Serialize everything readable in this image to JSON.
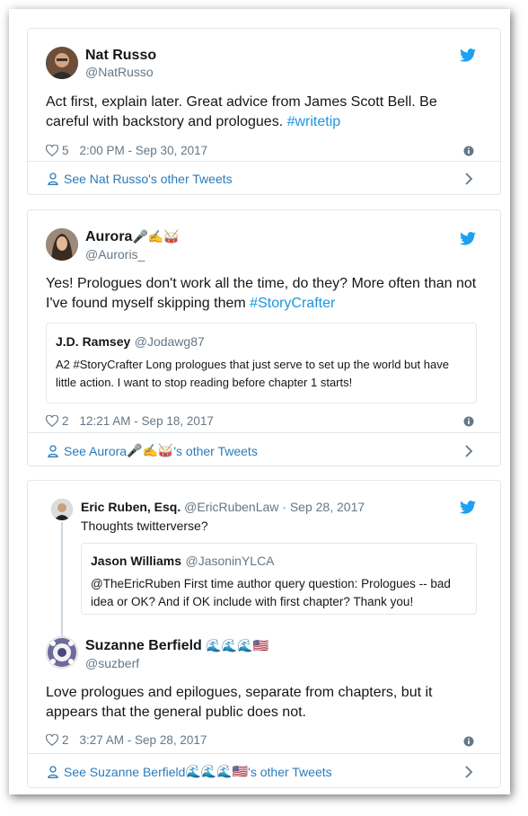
{
  "tweets": [
    {
      "name": "Nat Russo",
      "handle": "@NatRusso",
      "text": "Act first, explain later. Great advice from James Scott Bell. Be careful with backstory and prologues.",
      "hashtag": "#writetip",
      "likes": "5",
      "timestamp": "2:00 PM - Sep 30, 2017",
      "footer": "See Nat Russo's other Tweets"
    },
    {
      "name": "Aurora",
      "name_emoji": "🎤✍🥁",
      "handle": "@Auroris_",
      "text": "Yes! Prologues don't work all the time, do they? More often than not I've found myself skipping them",
      "hashtag": "#StoryCrafter",
      "quote": {
        "name": "J.D. Ramsey",
        "handle": "@Jodawg87",
        "text": "A2 #StoryCrafter Long prologues that just serve to set up the world but have little action. I want to stop reading before chapter 1 starts!"
      },
      "likes": "2",
      "timestamp": "12:21 AM - Sep 18, 2017",
      "footer_prefix": "See Aurora",
      "footer_emoji": "🎤✍🥁",
      "footer_suffix": "'s other Tweets"
    },
    {
      "parent": {
        "name": "Eric Ruben, Esq.",
        "handle": "@EricRubenLaw",
        "date": "· Sep 28, 2017",
        "text": "Thoughts twitterverse?",
        "quote": {
          "name": "Jason Williams",
          "handle": "@JasoninYLCA",
          "text": "@TheEricRuben First time author query question: Prologues -- bad idea or OK? And if OK include with first chapter? Thank you!"
        }
      },
      "name": "Suzanne Berfield",
      "name_emoji": "🌊🌊🌊🇺🇸",
      "handle": "@suzberf",
      "text": "Love prologues and epilogues, separate from chapters, but it appears that the general public does not.",
      "likes": "2",
      "timestamp": "3:27 AM - Sep 28, 2017",
      "footer_prefix": "See Suzanne Berfield",
      "footer_emoji": "🌊🌊🌊🇺🇸",
      "footer_suffix": "'s other Tweets"
    }
  ],
  "colors": {
    "link": "#2b7bb9",
    "hashtag": "#1b95e0",
    "muted": "#657786",
    "border": "#e1e8ed",
    "twitter_blue": "#1da1f2"
  },
  "icons": [
    "twitter-bird-icon",
    "heart-icon",
    "info-icon",
    "person-icon",
    "chevron-right-icon"
  ]
}
